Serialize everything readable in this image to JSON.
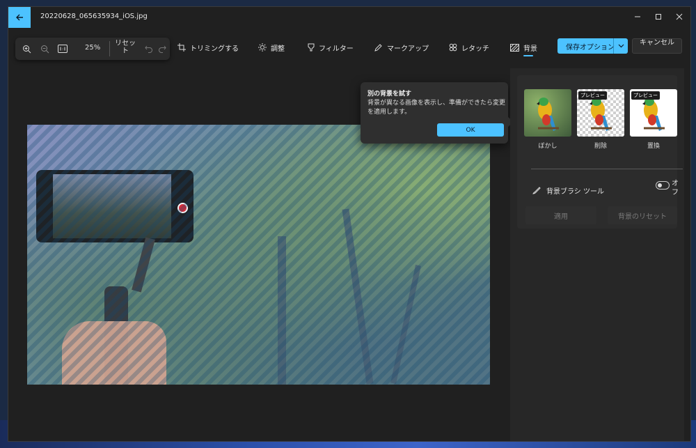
{
  "window": {
    "file_title": "20220628_065635934_iOS.jpg"
  },
  "zoom": {
    "level": "25%",
    "reset_label": "リセット"
  },
  "tools": {
    "crop": "トリミングする",
    "adjust": "調整",
    "filter": "フィルター",
    "markup": "マークアップ",
    "retouch": "レタッチ",
    "background": "背景"
  },
  "actions": {
    "save_options": "保存オプション",
    "cancel": "キャンセル"
  },
  "teaching_tip": {
    "title": "別の背景を試す",
    "body": "背景が異なる画像を表示し、準備ができたら変更を適用します。",
    "ok": "OK"
  },
  "background_panel": {
    "options": [
      {
        "label": "ぼかし",
        "tag": ""
      },
      {
        "label": "削除",
        "tag": "プレビュー"
      },
      {
        "label": "置換",
        "tag": "プレビュー"
      }
    ],
    "brush_tool_label": "背景ブラシ ツール",
    "brush_toggle_state": "オフ",
    "apply": "適用",
    "reset_background": "背景のリセット"
  },
  "colors": {
    "accent": "#4cc2ff",
    "window_bg": "#202020",
    "panel_bg": "#272727"
  }
}
